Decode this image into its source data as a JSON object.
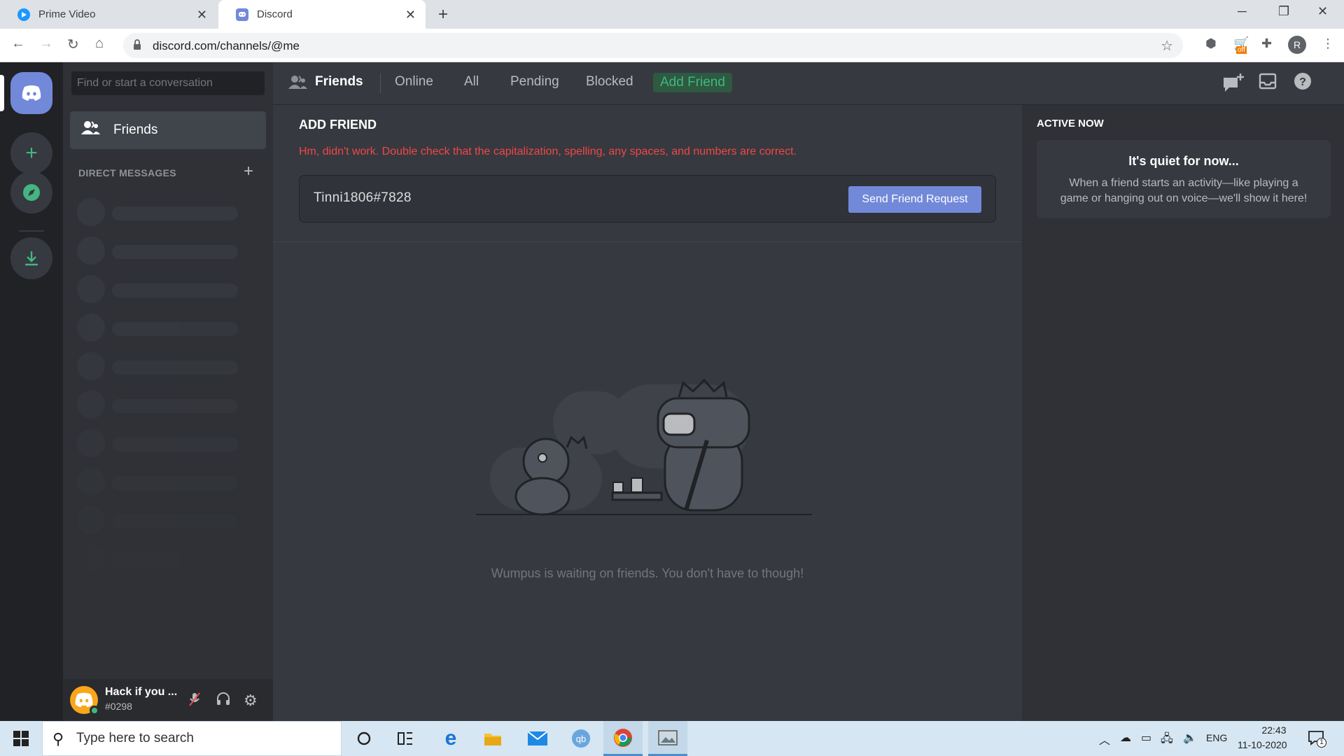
{
  "browser": {
    "tabs": [
      {
        "title": "Prime Video"
      },
      {
        "title": "Discord"
      }
    ],
    "url": "discord.com/channels/@me",
    "profile_initial": "R",
    "extension_badge": "off"
  },
  "sidebar": {
    "search_placeholder": "Find or start a conversation",
    "friends_label": "Friends",
    "direct_messages_header": "DIRECT MESSAGES"
  },
  "user": {
    "name": "Hack if you ...",
    "tag": "#0298"
  },
  "topbar": {
    "friends": "Friends",
    "tabs": [
      "Online",
      "All",
      "Pending",
      "Blocked"
    ],
    "add_friend": "Add Friend"
  },
  "add_friend": {
    "title": "ADD FRIEND",
    "error": "Hm, didn't work. Double check that the capitalization, spelling, any spaces, and numbers are correct.",
    "input_value": "Tinni1806#7828",
    "button": "Send Friend Request"
  },
  "empty_state": {
    "text": "Wumpus is waiting on friends. You don't have to though!"
  },
  "active_now": {
    "title": "ACTIVE NOW",
    "heading": "It's quiet for now...",
    "body": "When a friend starts an activity—like playing a game or hanging out on voice—we'll show it here!"
  },
  "taskbar": {
    "search_placeholder": "Type here to search",
    "lang": "ENG",
    "time": "22:43",
    "date": "11-10-2020",
    "notification_count": "1"
  },
  "colors": {
    "blurple": "#7289da",
    "green": "#43b581",
    "red": "#f04747"
  }
}
